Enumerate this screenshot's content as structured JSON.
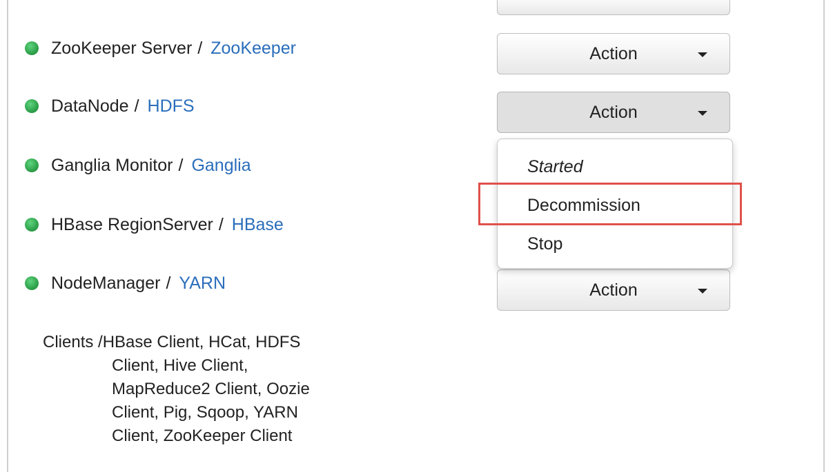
{
  "components": [
    {
      "name": "ZooKeeper Server",
      "separator": "/",
      "service": "ZooKeeper",
      "status": "started",
      "action_label": "Action"
    },
    {
      "name": "DataNode",
      "separator": "/",
      "service": "HDFS",
      "status": "started",
      "action_label": "Action"
    },
    {
      "name": "Ganglia Monitor",
      "separator": "/",
      "service": "Ganglia",
      "status": "started"
    },
    {
      "name": "HBase RegionServer",
      "separator": "/",
      "service": "HBase",
      "status": "started"
    },
    {
      "name": "NodeManager",
      "separator": "/",
      "service": "YARN",
      "status": "started",
      "action_label": "Action"
    }
  ],
  "dropdown": {
    "status_label": "Started",
    "items": [
      "Decommission",
      "Stop"
    ],
    "highlighted_item": "Decommission"
  },
  "clients": {
    "label": "Clients /HBase Client, HCat, HDFS",
    "lines": [
      "Client, Hive Client,",
      "MapReduce2 Client, Oozie",
      "Client, Pig, Sqoop, YARN",
      "Client, ZooKeeper Client"
    ]
  },
  "colors": {
    "status_green": "#2fa24c",
    "service_link": "#2a6ebb",
    "highlight_border": "#e0504a"
  }
}
